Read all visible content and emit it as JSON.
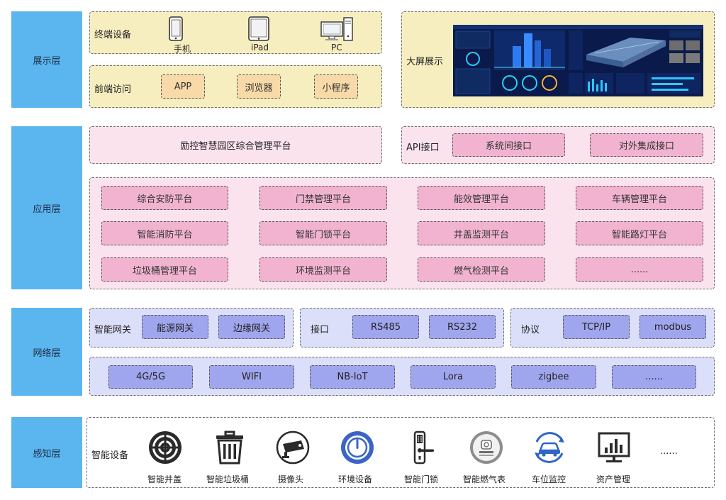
{
  "layers": {
    "display": "展示层",
    "application": "应用层",
    "network": "网络层",
    "perception": "感知层"
  },
  "display": {
    "terminal_label": "终端设备",
    "devices": [
      "手机",
      "iPad",
      "PC"
    ],
    "frontend_label": "前端访问",
    "frontend_items": [
      "APP",
      "浏览器",
      "小程序"
    ],
    "bigscreen_label": "大屏展示"
  },
  "application": {
    "platform_title": "励控智慧园区综合管理平台",
    "api_label": "API接口",
    "api_items": [
      "系统间接口",
      "对外集成接口"
    ],
    "platforms": [
      [
        "综合安防平台",
        "门禁管理平台",
        "能效管理平台",
        "车辆管理平台"
      ],
      [
        "智能消防平台",
        "智能门锁平台",
        "井盖监测平台",
        "智能路灯平台"
      ],
      [
        "垃圾桶管理平台",
        "环境监测平台",
        "燃气检测平台",
        "......"
      ]
    ]
  },
  "network": {
    "gateway_label": "智能网关",
    "gateways": [
      "能源网关",
      "边缘网关"
    ],
    "interface_label": "接口",
    "interfaces": [
      "RS485",
      "RS232"
    ],
    "protocol_label": "协议",
    "protocols": [
      "TCP/IP",
      "modbus"
    ],
    "links": [
      "4G/5G",
      "WIFI",
      "NB-IoT",
      "Lora",
      "zigbee",
      "......"
    ]
  },
  "perception": {
    "label": "智能设备",
    "devices": [
      {
        "name": "智能井盖",
        "icon": "manhole-icon"
      },
      {
        "name": "智能垃圾桶",
        "icon": "trash-can-icon"
      },
      {
        "name": "摄像头",
        "icon": "camera-icon"
      },
      {
        "name": "环境设备",
        "icon": "environment-sensor-icon"
      },
      {
        "name": "智能门锁",
        "icon": "door-lock-icon"
      },
      {
        "name": "智能燃气表",
        "icon": "gas-meter-icon"
      },
      {
        "name": "车位监控",
        "icon": "parking-monitor-icon"
      },
      {
        "name": "资产管理",
        "icon": "asset-chart-icon"
      }
    ],
    "more": "......"
  },
  "colors": {
    "layer_label": "#5bb5ef",
    "display_panel": "#f6eebf",
    "display_chip": "#f8d9a8",
    "app_panel": "#fbe3ee",
    "app_chip": "#f1b3d0",
    "network_panel": "#dcdffa",
    "network_chip": "#9fa6ee"
  }
}
